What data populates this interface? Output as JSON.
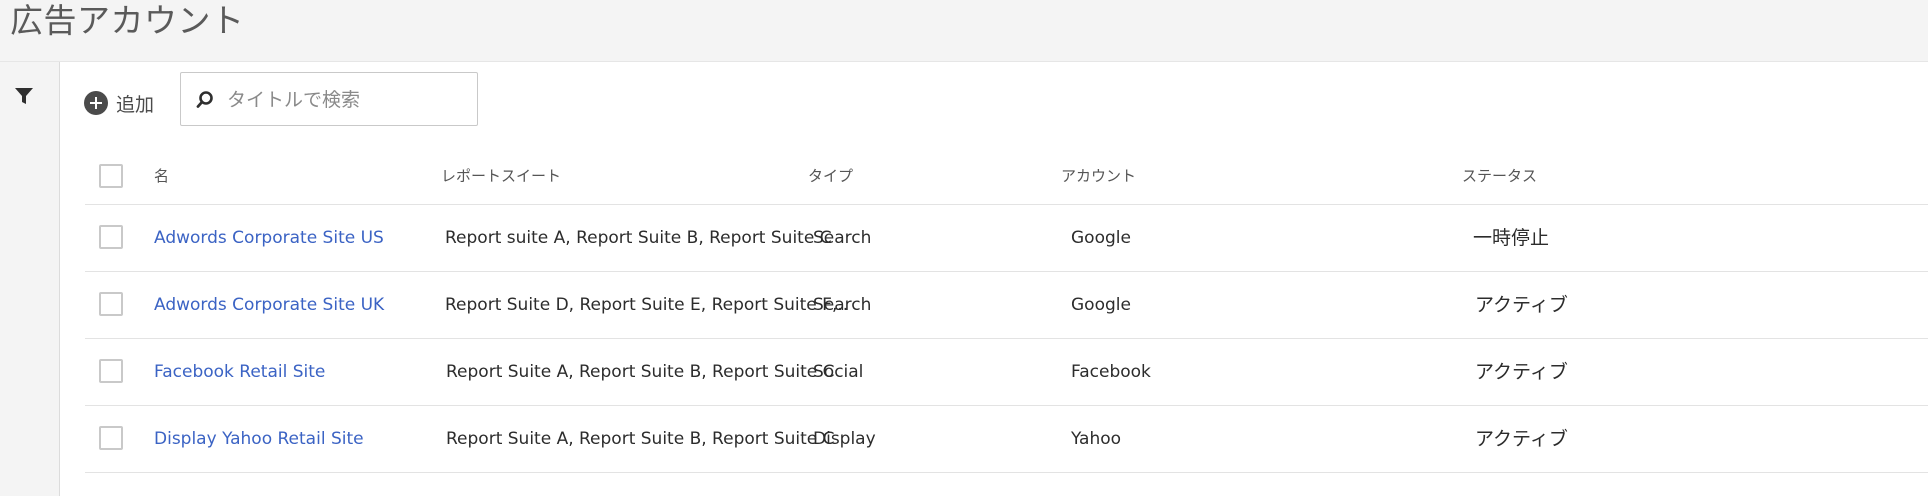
{
  "page": {
    "title": "広告アカウント"
  },
  "toolbar": {
    "add_label": "追加"
  },
  "search": {
    "placeholder": "タイトルで検索"
  },
  "table": {
    "columns": [
      "名",
      "レポートスイート",
      "タイプ",
      "アカウント",
      "ステータス"
    ],
    "rows": [
      {
        "name": "Adwords Corporate Site US",
        "suites": "Report suite A, Report Suite B, Report Suite C",
        "type": "Search",
        "account": "Google",
        "status": "一時停止"
      },
      {
        "name": "Adwords Corporate Site UK",
        "suites": "Report Suite D, Report Suite E, Report Suite F,..",
        "type": "Search",
        "account": "Google",
        "status": "アクティブ"
      },
      {
        "name": "Facebook Retail Site",
        "suites": "Report Suite A, Report Suite B, Report Suite C",
        "type": "Social",
        "account": "Facebook",
        "status": "アクティブ"
      },
      {
        "name": "Display Yahoo Retail Site",
        "suites": "Report Suite A, Report Suite B, Report Suite C",
        "type": "Display",
        "account": "Yahoo",
        "status": "アクティブ"
      }
    ]
  },
  "icons": {
    "filter": "filter-icon",
    "search": "search-icon",
    "add": "plus-circle-icon"
  },
  "colors": {
    "link": "#3b63c4",
    "rail": "#f4f4f4"
  }
}
